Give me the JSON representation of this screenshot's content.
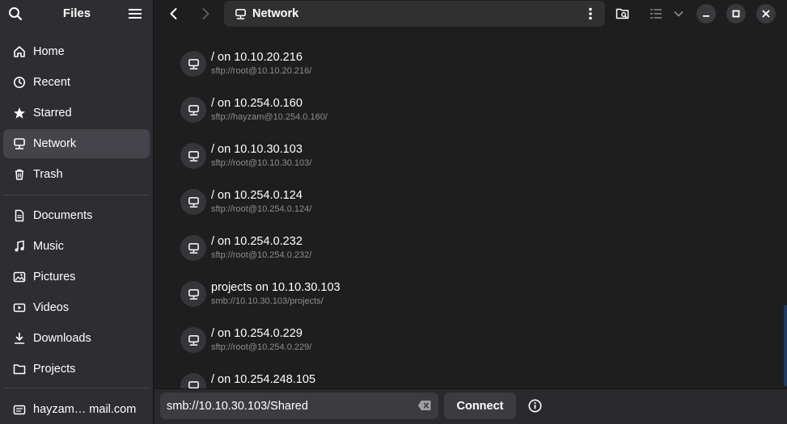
{
  "app": {
    "title": "Files"
  },
  "sidebar": {
    "items": [
      {
        "label": "Home",
        "icon": "home-icon"
      },
      {
        "label": "Recent",
        "icon": "clock-icon"
      },
      {
        "label": "Starred",
        "icon": "star-icon"
      },
      {
        "label": "Network",
        "icon": "network-icon",
        "active": true
      },
      {
        "label": "Trash",
        "icon": "trash-icon"
      },
      {
        "label": "Documents",
        "icon": "document-icon"
      },
      {
        "label": "Music",
        "icon": "music-icon"
      },
      {
        "label": "Pictures",
        "icon": "picture-icon"
      },
      {
        "label": "Videos",
        "icon": "video-icon"
      },
      {
        "label": "Downloads",
        "icon": "download-icon"
      },
      {
        "label": "Projects",
        "icon": "folder-icon"
      }
    ],
    "account": {
      "label": "hayzam… mail.com",
      "icon": "account-icon"
    }
  },
  "header": {
    "location": "Network"
  },
  "servers": [
    {
      "name": "/ on 10.10.20.216",
      "url": "sftp://root@10.10.20.216/"
    },
    {
      "name": "/ on 10.254.0.160",
      "url": "sftp://hayzam@10.254.0.160/"
    },
    {
      "name": "/ on 10.10.30.103",
      "url": "sftp://root@10.10.30.103/"
    },
    {
      "name": "/ on 10.254.0.124",
      "url": "sftp://root@10.254.0.124/"
    },
    {
      "name": "/ on 10.254.0.232",
      "url": "sftp://root@10.254.0.232/"
    },
    {
      "name": "projects on 10.10.30.103",
      "url": "smb://10.10.30.103/projects/"
    },
    {
      "name": "/ on 10.254.0.229",
      "url": "sftp://root@10.254.0.229/"
    },
    {
      "name": "/ on 10.254.248.105",
      "url": ""
    }
  ],
  "connect_bar": {
    "address_value": "smb://10.10.30.103/Shared",
    "connect_label": "Connect"
  },
  "colors": {
    "sidebar_bg": "#2e2e32",
    "main_bg": "#1e1e1e",
    "active_item": "#44444a",
    "secondary_text": "#8d8d92"
  }
}
